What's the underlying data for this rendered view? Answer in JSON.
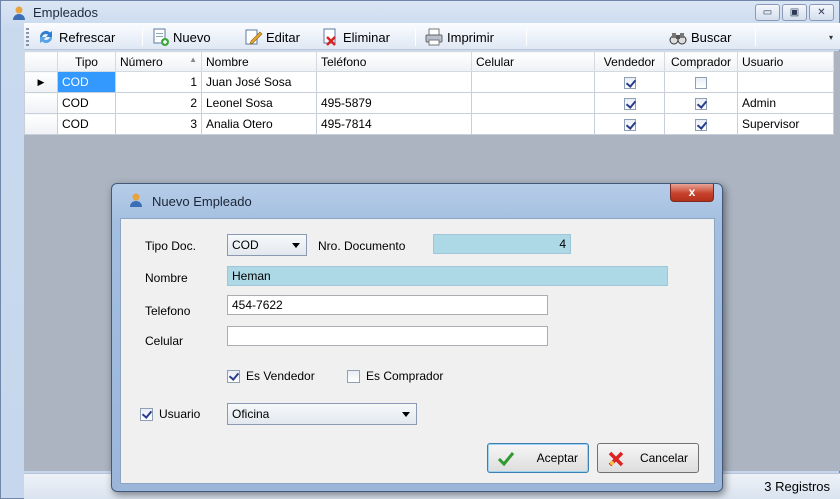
{
  "window": {
    "title": "Empleados",
    "min": "▭",
    "max": "▣",
    "close": "✕"
  },
  "toolbar": {
    "refresh_label": "Refrescar",
    "new_label": "Nuevo",
    "edit_label": "Editar",
    "delete_label": "Eliminar",
    "print_label": "Imprimir",
    "search_label": "Buscar"
  },
  "grid": {
    "columns": [
      "Tipo",
      "Número",
      "Nombre",
      "Teléfono",
      "Celular",
      "Vendedor",
      "Comprador",
      "Usuario"
    ],
    "rows": [
      {
        "tipo": "COD",
        "numero": "1",
        "nombre": "Juan José Sosa",
        "telefono": "",
        "celular": "",
        "vendedor": true,
        "comprador": false,
        "usuario": ""
      },
      {
        "tipo": "COD",
        "numero": "2",
        "nombre": "Leonel Sosa",
        "telefono": "495-5879",
        "celular": "",
        "vendedor": true,
        "comprador": true,
        "usuario": "Admin"
      },
      {
        "tipo": "COD",
        "numero": "3",
        "nombre": "Analia Otero",
        "telefono": "495-7814",
        "celular": "",
        "vendedor": true,
        "comprador": true,
        "usuario": "Supervisor"
      }
    ]
  },
  "status": {
    "records": "3 Registros"
  },
  "dialog": {
    "title": "Nuevo Empleado",
    "close": "x",
    "tipo_doc_label": "Tipo Doc.",
    "tipo_doc_value": "COD",
    "nro_doc_label": "Nro. Documento",
    "nro_doc_value": "4",
    "nombre_label": "Nombre",
    "nombre_value": "Heman",
    "telefono_label": "Telefono",
    "telefono_value": "454-7622",
    "celular_label": "Celular",
    "celular_value": "",
    "es_vendedor_label": "Es Vendedor",
    "es_vendedor_checked": true,
    "es_comprador_label": "Es Comprador",
    "es_comprador_checked": false,
    "usuario_label": "Usuario",
    "usuario_checked": true,
    "usuario_value": "Oficina",
    "accept_label": "Aceptar",
    "cancel_label": "Cancelar"
  }
}
